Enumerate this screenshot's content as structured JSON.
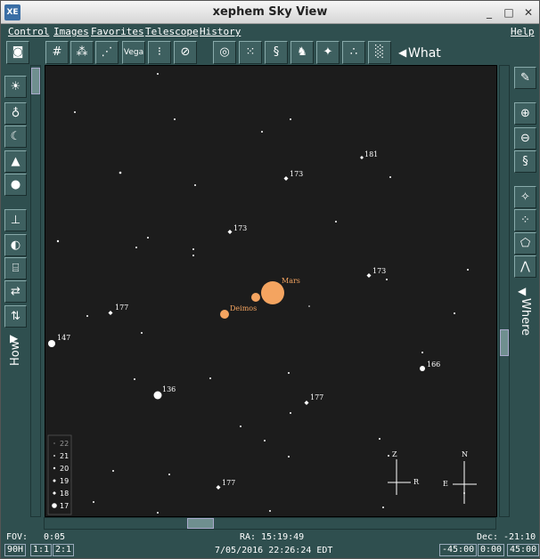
{
  "window": {
    "title": "xephem Sky View",
    "app_icon": "XE",
    "controls": [
      "_",
      "□",
      "✕"
    ]
  },
  "menu": [
    "Control",
    "Images",
    "Favorites",
    "Telescope",
    "History",
    "Help"
  ],
  "toolbar": {
    "buttons": [
      "grid-icon",
      "trees-icon",
      "constellation-icon",
      "vega-icon",
      "labels-icon",
      "galaxy-icon",
      "target-icon",
      "cluster-icon",
      "swirl-icon",
      "horse-icon",
      "stars-icon",
      "dots-icon",
      "noise-icon"
    ],
    "vega_label": "Vega",
    "what_label": "What",
    "arrow": "◀"
  },
  "left_panel": {
    "how_label": "How",
    "arrow": "▶"
  },
  "right_panel": {
    "where_label": "Where",
    "arrow": "◀"
  },
  "sky": {
    "objects": [
      {
        "name": "Mars",
        "color": "#f4a460"
      },
      {
        "name": "Deimos",
        "color": "#f4a460"
      }
    ],
    "star_labels": [
      "181",
      "173",
      "173",
      "173",
      "177",
      "147",
      "136",
      "166",
      "177",
      "177"
    ],
    "legend": [
      "22",
      "21",
      "20",
      "19",
      "18",
      "17"
    ],
    "compass": {
      "zenith": "Z",
      "right": "R",
      "north": "N",
      "east": "E"
    }
  },
  "status": {
    "fov_label": "FOV:",
    "fov_value": "0:05",
    "ra_label": "RA:",
    "ra_value": "15:19:49",
    "dec_label": "Dec:",
    "dec_value": "-21:10",
    "datetime": "7/05/2016  22:26:24 EDT",
    "left_boxes": [
      "90H",
      "1:1",
      "2:1"
    ],
    "right_boxes": [
      "-45:00",
      "0:00",
      "45:00"
    ]
  }
}
